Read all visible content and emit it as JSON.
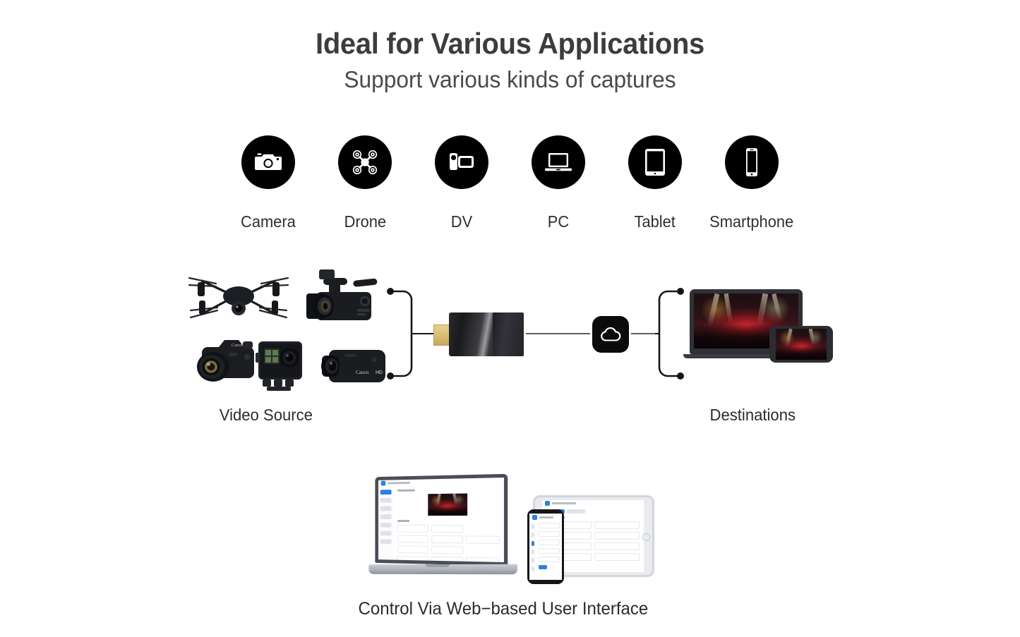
{
  "heading": {
    "title": "Ideal for Various Applications",
    "subtitle": "Support various kinds of captures"
  },
  "sources_row": {
    "items": [
      {
        "label": "Camera",
        "icon": "camera-icon"
      },
      {
        "label": "Drone",
        "icon": "drone-icon"
      },
      {
        "label": "DV",
        "icon": "camcorder-icon"
      },
      {
        "label": "PC",
        "icon": "laptop-icon"
      },
      {
        "label": "Tablet",
        "icon": "tablet-icon"
      },
      {
        "label": "Smartphone",
        "icon": "smartphone-icon"
      }
    ]
  },
  "diagram": {
    "source_caption": "Video Source",
    "destination_caption": "Destinations",
    "cloud_icon": "cloud-icon",
    "encoder_icon": "hdmi-encoder-dongle",
    "source_devices": [
      "drone",
      "professional-camcorder",
      "dslr-camera",
      "action-camera",
      "handheld-camcorder"
    ],
    "destination_devices": [
      "laptop",
      "smartphone"
    ]
  },
  "ui_section": {
    "caption": "Control Via Web−based User Interface",
    "devices": [
      "laptop",
      "tablet",
      "smartphone"
    ]
  },
  "colors": {
    "icon_background": "#000000",
    "title_text": "#3c3c3c",
    "body_text": "#2f2f2f",
    "ui_accent": "#2f7fe0",
    "connector": "#161616",
    "dongle_gold": "#d9bf75"
  }
}
